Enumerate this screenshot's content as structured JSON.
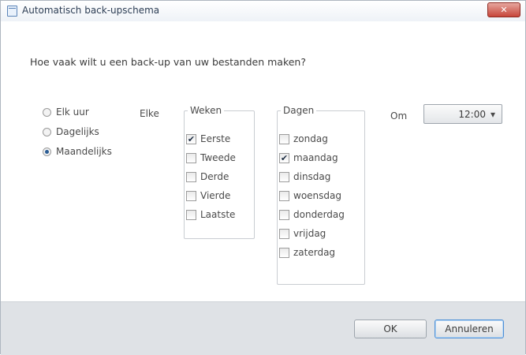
{
  "window": {
    "title": "Automatisch back-upschema",
    "close_glyph": "✕"
  },
  "question": "Hoe vaak wilt u een back-up van uw bestanden maken?",
  "frequency": {
    "options": [
      {
        "label": "Elk uur",
        "selected": false
      },
      {
        "label": "Dagelijks",
        "selected": false
      },
      {
        "label": "Maandelijks",
        "selected": true
      }
    ]
  },
  "elke_label": "Elke",
  "weeks": {
    "legend": "Weken",
    "items": [
      {
        "label": "Eerste",
        "checked": true,
        "mark": "✔"
      },
      {
        "label": "Tweede",
        "checked": false,
        "mark": ""
      },
      {
        "label": "Derde",
        "checked": false,
        "mark": ""
      },
      {
        "label": "Vierde",
        "checked": false,
        "mark": ""
      },
      {
        "label": "Laatste",
        "checked": false,
        "mark": ""
      }
    ]
  },
  "days": {
    "legend": "Dagen",
    "items": [
      {
        "label": "zondag",
        "checked": false,
        "mark": ""
      },
      {
        "label": "maandag",
        "checked": true,
        "mark": "✔"
      },
      {
        "label": "dinsdag",
        "checked": false,
        "mark": ""
      },
      {
        "label": "woensdag",
        "checked": false,
        "mark": ""
      },
      {
        "label": "donderdag",
        "checked": false,
        "mark": ""
      },
      {
        "label": "vrijdag",
        "checked": false,
        "mark": ""
      },
      {
        "label": "zaterdag",
        "checked": false,
        "mark": ""
      }
    ]
  },
  "time": {
    "label": "Om",
    "value": "12:00",
    "arrow": "▾"
  },
  "buttons": {
    "ok": "OK",
    "cancel": "Annuleren"
  }
}
